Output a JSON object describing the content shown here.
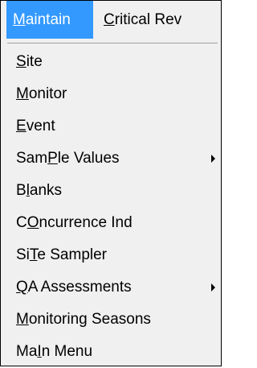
{
  "menubar": {
    "maintain": {
      "mnemonic": "M",
      "rest": "aintain"
    },
    "critical_rev": {
      "mnemonic": "C",
      "rest": "ritical Rev"
    }
  },
  "menu": {
    "items": [
      {
        "before": "",
        "mnemonic": "S",
        "after": "ite",
        "has_submenu": false
      },
      {
        "before": "",
        "mnemonic": "M",
        "after": "onitor",
        "has_submenu": false
      },
      {
        "before": "",
        "mnemonic": "E",
        "after": "vent",
        "has_submenu": false
      },
      {
        "before": "Sam",
        "mnemonic": "P",
        "after": "le Values",
        "has_submenu": true
      },
      {
        "before": "B",
        "mnemonic": "l",
        "after": "anks",
        "has_submenu": false
      },
      {
        "before": "C",
        "mnemonic": "O",
        "after": "ncurrence Ind",
        "has_submenu": false
      },
      {
        "before": "Si",
        "mnemonic": "T",
        "after": "e Sampler",
        "has_submenu": false
      },
      {
        "before": "",
        "mnemonic": "Q",
        "after": "A Assessments",
        "has_submenu": true
      },
      {
        "before": "",
        "mnemonic": "M",
        "after": "onitoring Seasons",
        "has_submenu": false
      },
      {
        "before": "Ma",
        "mnemonic": "I",
        "after": "n Menu",
        "has_submenu": false
      }
    ]
  },
  "colors": {
    "highlight": "#3399ff",
    "menu_background": "#f0f0f0",
    "text": "#000000"
  },
  "icons": {
    "submenu_indicator": "submenu-arrow-icon"
  }
}
